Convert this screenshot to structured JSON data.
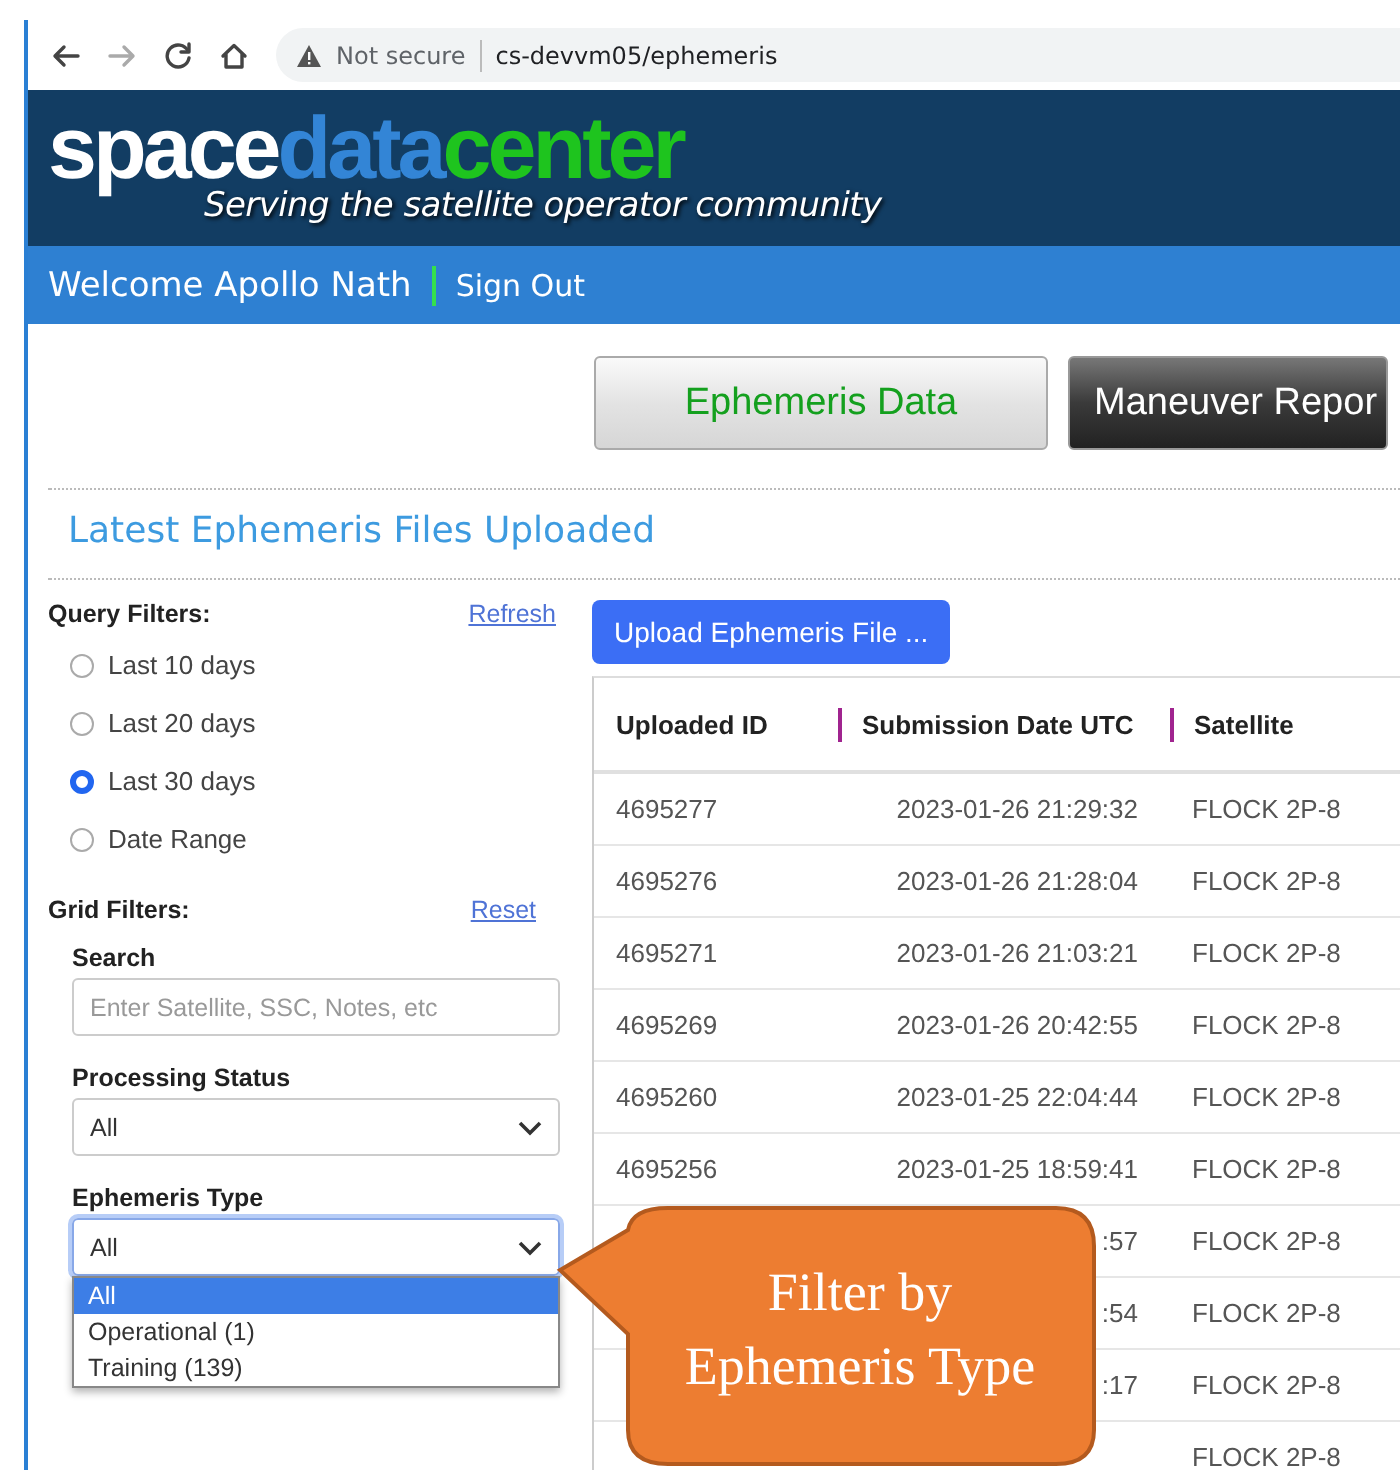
{
  "browser": {
    "security": "Not secure",
    "url": "cs-devvm05/ephemeris"
  },
  "header": {
    "logo_parts": [
      {
        "text": "space",
        "color": "#ffffff"
      },
      {
        "text": "data",
        "color": "#3385d6"
      },
      {
        "text": "center",
        "color": "#1ec41e"
      }
    ],
    "tagline": "Serving the satellite operator community"
  },
  "user_bar": {
    "welcome": "Welcome Apollo Nath",
    "sign_out": "Sign Out"
  },
  "nav_buttons": [
    {
      "label": "Ephemeris Data",
      "selected": true
    },
    {
      "label": "Maneuver Repor",
      "selected": false
    }
  ],
  "page_title": "Latest Ephemeris Files Uploaded",
  "query_filters": {
    "title": "Query Filters:",
    "refresh": "Refresh",
    "options": [
      {
        "label": "Last 10 days",
        "selected": false
      },
      {
        "label": "Last 20 days",
        "selected": false
      },
      {
        "label": "Last 30 days",
        "selected": true
      },
      {
        "label": "Date Range",
        "selected": false
      }
    ]
  },
  "grid_filters": {
    "title": "Grid Filters:",
    "reset": "Reset",
    "search": {
      "label": "Search",
      "placeholder": "Enter Satellite, SSC, Notes, etc"
    },
    "processing_status": {
      "label": "Processing Status",
      "value": "All"
    },
    "ephemeris_type": {
      "label": "Ephemeris Type",
      "value": "All",
      "expanded": true,
      "options": [
        {
          "label": "All",
          "selected": true
        },
        {
          "label": "Operational (1)",
          "selected": false
        },
        {
          "label": "Training (139)",
          "selected": false
        }
      ]
    }
  },
  "upload_button": "Upload Ephemeris File ...",
  "table": {
    "columns": [
      "Uploaded ID",
      "Submission Date UTC",
      "Satellite"
    ],
    "rows": [
      [
        "4695277",
        "2023-01-26 21:29:32",
        "FLOCK 2P-8"
      ],
      [
        "4695276",
        "2023-01-26 21:28:04",
        "FLOCK 2P-8"
      ],
      [
        "4695271",
        "2023-01-26 21:03:21",
        "FLOCK 2P-8"
      ],
      [
        "4695269",
        "2023-01-26 20:42:55",
        "FLOCK 2P-8"
      ],
      [
        "4695260",
        "2023-01-25 22:04:44",
        "FLOCK 2P-8"
      ],
      [
        "4695256",
        "2023-01-25 18:59:41",
        "FLOCK 2P-8"
      ],
      [
        "",
        ":57",
        "FLOCK 2P-8"
      ],
      [
        "",
        ":54",
        "FLOCK 2P-8"
      ],
      [
        "",
        ":17",
        "FLOCK 2P-8"
      ],
      [
        "",
        "",
        "FLOCK 2P-8"
      ]
    ]
  },
  "callout": {
    "text": "Filter by Ephemeris Type"
  }
}
